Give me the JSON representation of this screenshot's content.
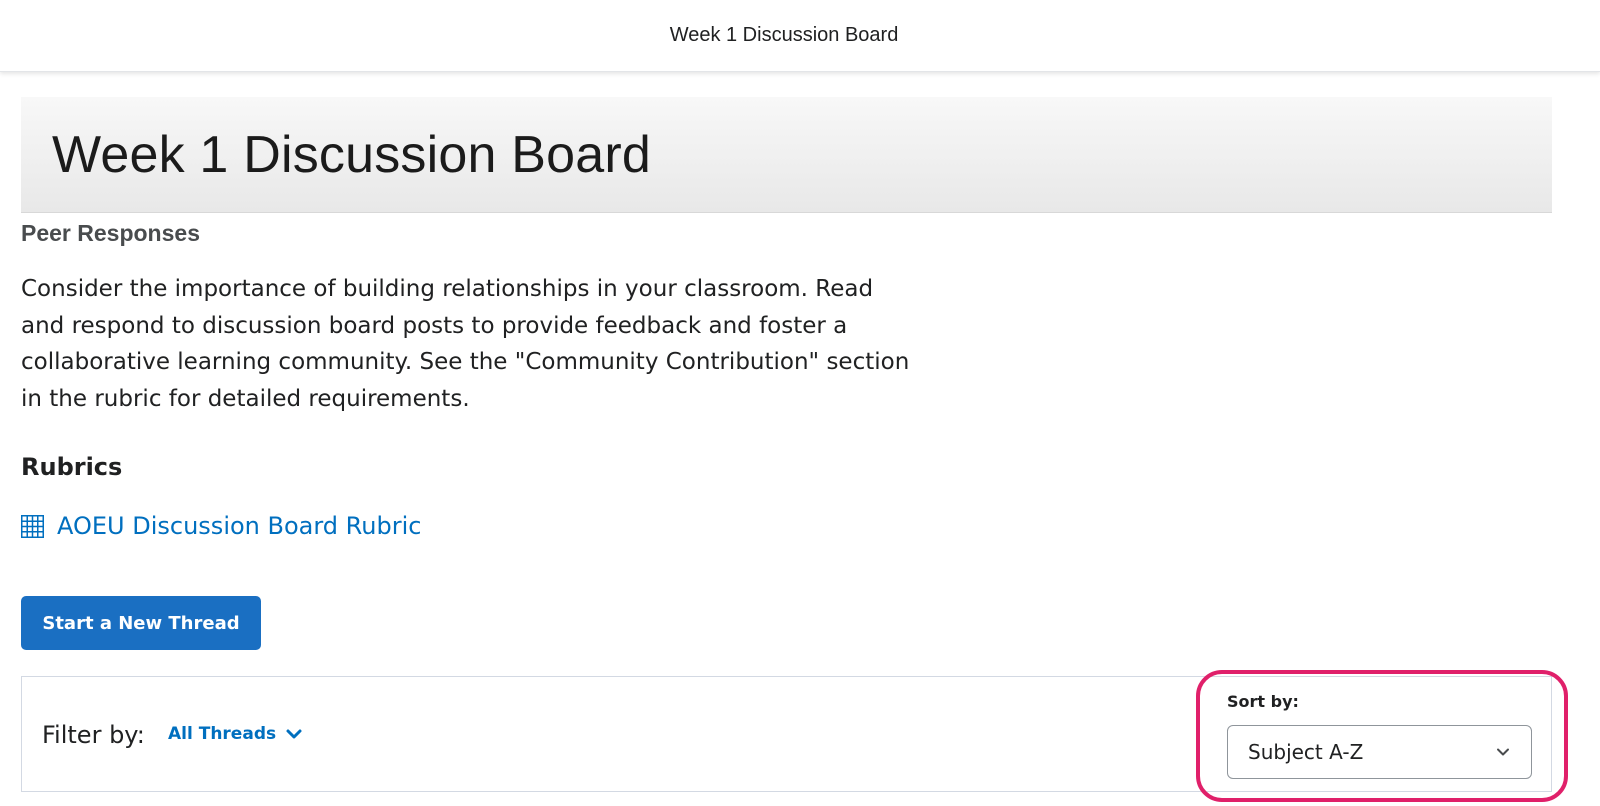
{
  "topbar": {
    "title": "Week 1 Discussion Board"
  },
  "banner": {
    "title": "Week 1 Discussion Board"
  },
  "content": {
    "section_heading": "Peer Responses",
    "description": "Consider the importance of building relationships in your classroom. Read and respond to discussion board posts to provide feedback and foster a collaborative learning community. See the \"Community Contribution\" section in the rubric for detailed requirements.",
    "rubrics_heading": "Rubrics",
    "rubric_link": {
      "label": "AOEU Discussion Board Rubric",
      "icon": "grid-icon"
    }
  },
  "actions": {
    "start_thread_label": "Start a New Thread"
  },
  "filter": {
    "label": "Filter by:",
    "selected": "All Threads",
    "icon": "chevron-down-icon"
  },
  "sort": {
    "label": "Sort by:",
    "selected": "Subject A-Z",
    "icon": "chevron-down-icon"
  },
  "colors": {
    "link": "#006fbf",
    "primary_button": "#1a6fc2",
    "highlight": "#e0206a"
  }
}
